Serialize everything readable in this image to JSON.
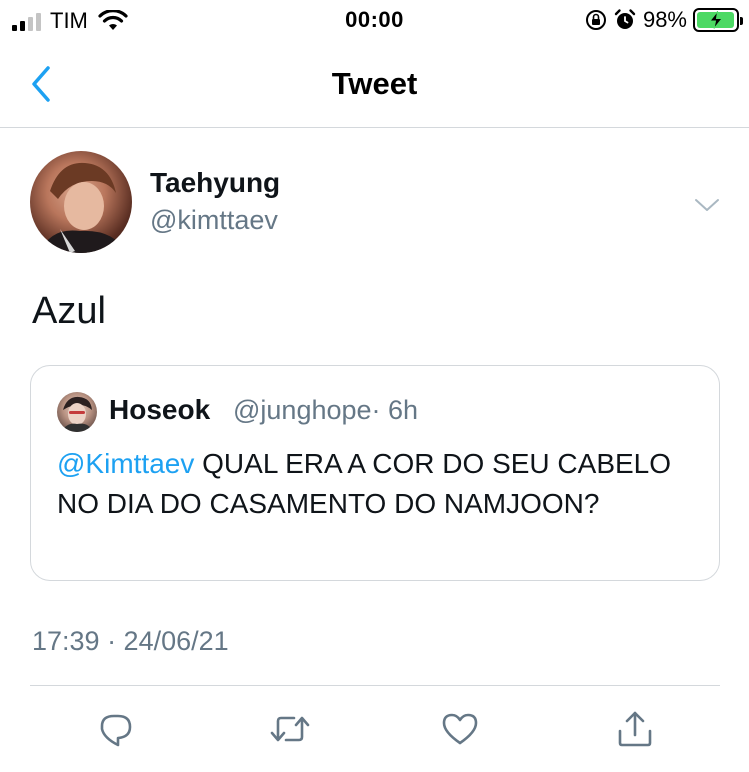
{
  "status_bar": {
    "carrier": "TIM",
    "time": "00:00",
    "battery_percent": "98%",
    "battery_level": 0.98,
    "icons": [
      "signal-icon",
      "wifi-icon",
      "orientation-lock-icon",
      "alarm-icon",
      "battery-charging-icon"
    ]
  },
  "nav": {
    "title": "Tweet",
    "back_icon": "chevron-left-icon"
  },
  "tweet": {
    "author_name": "Taehyung",
    "author_handle": "@kimttaev",
    "text": "Azul",
    "timestamp": "17:39 · 24/06/21",
    "more_icon": "chevron-down-icon"
  },
  "quoted_tweet": {
    "author_name": "Hoseok",
    "author_handle": "@junghope",
    "time_ago": "· 6h",
    "mention": "@Kimttaev",
    "text": " QUAL ERA A COR DO SEU CABELO NO DIA DO CASAMENTO DO NAMJOON?"
  },
  "actions": [
    "reply-icon",
    "retweet-icon",
    "like-icon",
    "share-icon"
  ],
  "colors": {
    "accent": "#1da1f2",
    "secondary_text": "#657786",
    "battery_charging": "#4cd964",
    "divider": "#d4d8dc"
  }
}
